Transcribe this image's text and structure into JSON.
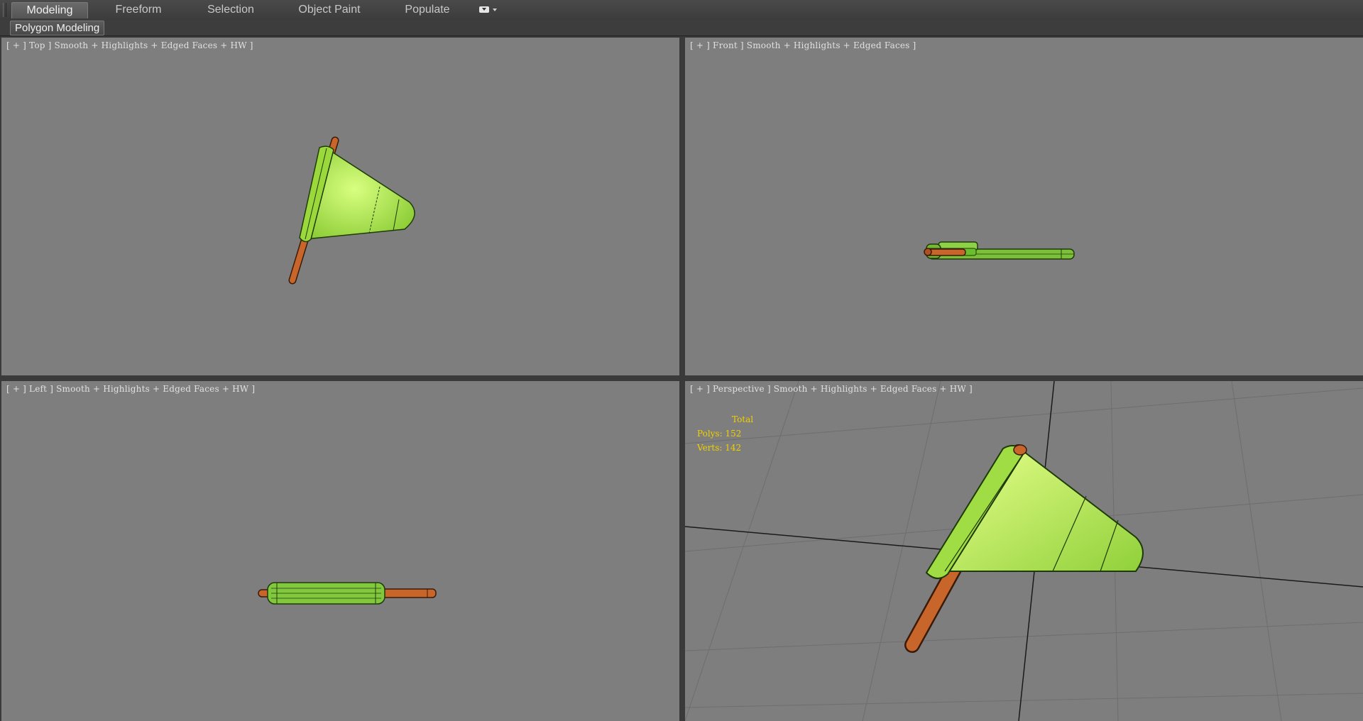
{
  "ribbon": {
    "tabs": [
      {
        "label": "Modeling",
        "active": true
      },
      {
        "label": "Freeform",
        "active": false
      },
      {
        "label": "Selection",
        "active": false
      },
      {
        "label": "Object Paint",
        "active": false
      },
      {
        "label": "Populate",
        "active": false
      }
    ],
    "menu_icon": "dropdown-menu-icon",
    "panel_label": "Polygon Modeling"
  },
  "viewports": {
    "top": {
      "label": "[ + ] Top ] Smooth + Highlights + Edged Faces + HW ]"
    },
    "front": {
      "label": "[ + ] Front ] Smooth + Highlights + Edged Faces ]"
    },
    "left": {
      "label": "[ + ] Left ] Smooth + Highlights + Edged Faces + HW ]"
    },
    "perspective": {
      "label": "[ + ] Perspective ] Smooth + Highlights + Edged Faces + HW ]",
      "stats": {
        "title": "Total",
        "polys": "Polys: 152",
        "verts": "Verts: 142"
      }
    }
  },
  "colors": {
    "viewport_bg": "#7e7e7e",
    "flag_green": "#a8e048",
    "pole_orange": "#c8652a",
    "stats_yellow": "#f0d000"
  }
}
